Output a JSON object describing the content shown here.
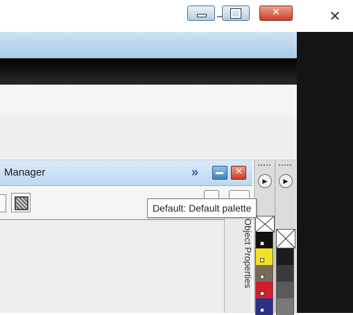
{
  "os_window": {
    "minimize_glyph": "—",
    "restore_glyph": "⧉",
    "close_glyph": "✕"
  },
  "inner_window": {
    "buttons": [
      "minimize-icon",
      "restore-icon",
      "close-icon"
    ]
  },
  "docker": {
    "title": "Manager",
    "expand_glyph": "»"
  },
  "side_tab": {
    "label": "Object Properties"
  },
  "tooltip": {
    "text": "Default: Default palette"
  },
  "palette": {
    "colors_left": [
      "#111111",
      "#f3e021",
      "#7a6a5a",
      "#d21f2b",
      "#2b2f8a"
    ],
    "colors_right": [
      "#1c1c1c",
      "#3a3a3a",
      "#5a5a5a",
      "#7a7a7a"
    ]
  }
}
